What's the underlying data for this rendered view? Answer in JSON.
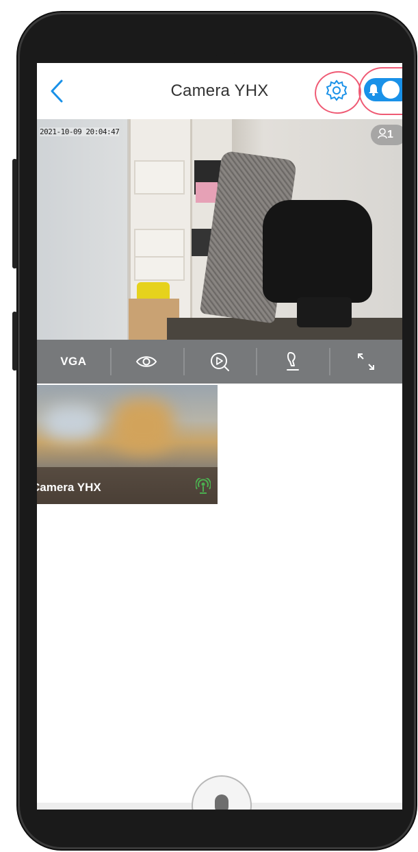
{
  "header": {
    "title": "Camera YHX"
  },
  "video": {
    "timestamp": "2021-10-09 20:04:47",
    "viewer_count": "1"
  },
  "controls": {
    "resolution_label": "VGA",
    "items": [
      "eye-icon",
      "playback-icon",
      "intercom-icon",
      "fullscreen-icon"
    ]
  },
  "device_list": [
    {
      "name": "Camera YHX",
      "status_icon": "online-signal-icon"
    }
  ],
  "colors": {
    "accent": "#1991e8",
    "control_bar": "#77797b",
    "annotation": "#ef5a74",
    "online": "#4caf50"
  }
}
